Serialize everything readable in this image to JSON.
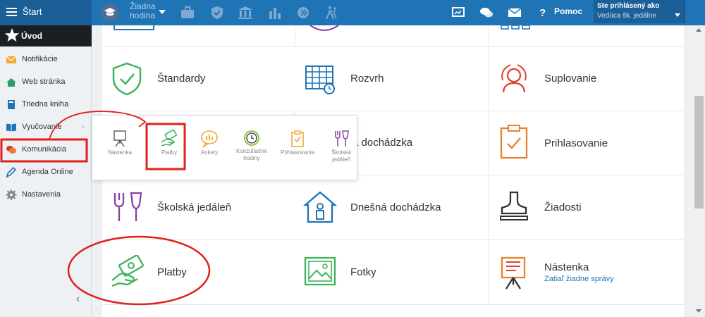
{
  "topbar": {
    "start_label": "Štart",
    "hour_line1": "Žiadna",
    "hour_line2": "hodina",
    "help_label": "Pomoc",
    "user_line1": "Ste prihlásený ako",
    "user_line2": "Vedúca šk. jedálne",
    "icons": [
      "briefcase-icon",
      "shield-icon",
      "institution-icon",
      "bar-chart-icon",
      "speed-icon",
      "walk-icon",
      "cast-icon",
      "chat-icon",
      "mail-icon",
      "help-icon"
    ]
  },
  "sidebar": {
    "header": "Úvod",
    "items": [
      {
        "label": "Notifikácie",
        "icon": "envelope-icon"
      },
      {
        "label": "Web stránka",
        "icon": "home-icon"
      },
      {
        "label": "Triedna kniha",
        "icon": "book-icon"
      },
      {
        "label": "Vyučovanie",
        "icon": "open-book-icon"
      },
      {
        "label": "Komunikácia",
        "icon": "chat-bubbles-icon"
      },
      {
        "label": "Agenda Online",
        "icon": "pencil-icon"
      },
      {
        "label": "Nastavenia",
        "icon": "gear-icon"
      }
    ],
    "collapse_symbol": "‹"
  },
  "flyout": {
    "items": [
      {
        "label": "Nástenka",
        "icon": "easel-icon"
      },
      {
        "label": "Platby",
        "icon": "money-hand-icon"
      },
      {
        "label": "Ankety",
        "icon": "poll-icon"
      },
      {
        "label_line1": "Konzultačné",
        "label_line2": "hodiny",
        "icon": "clock-icon"
      },
      {
        "label": "Prihlasovanie",
        "icon": "clipboard-icon"
      },
      {
        "label_line1": "Školská",
        "label_line2": "jedáleň",
        "icon": "cutlery-icon"
      }
    ]
  },
  "tiles": {
    "standardy": "Štandardy",
    "rozvrh": "Rozvrh",
    "suplovanie": "Suplovanie",
    "dochadzka_partial": "a dochádzka",
    "prihlasovanie": "Prihlasovanie",
    "jedalen": "Školská jedáleň",
    "dnesna": "Dnešná dochádzka",
    "ziadosti": "Žiadosti",
    "platby": "Platby",
    "fotky": "Fotky",
    "nastenka": "Nástenka",
    "nastenka_sub": "Zatiaľ žiadne správy"
  },
  "colors": {
    "topbar": "#1f74b5",
    "annotation_red": "#e0201c",
    "green": "#3fb45a",
    "blue": "#1f74b5",
    "red": "#e0422c",
    "orange": "#e8822e",
    "purple": "#8a3fa8"
  }
}
